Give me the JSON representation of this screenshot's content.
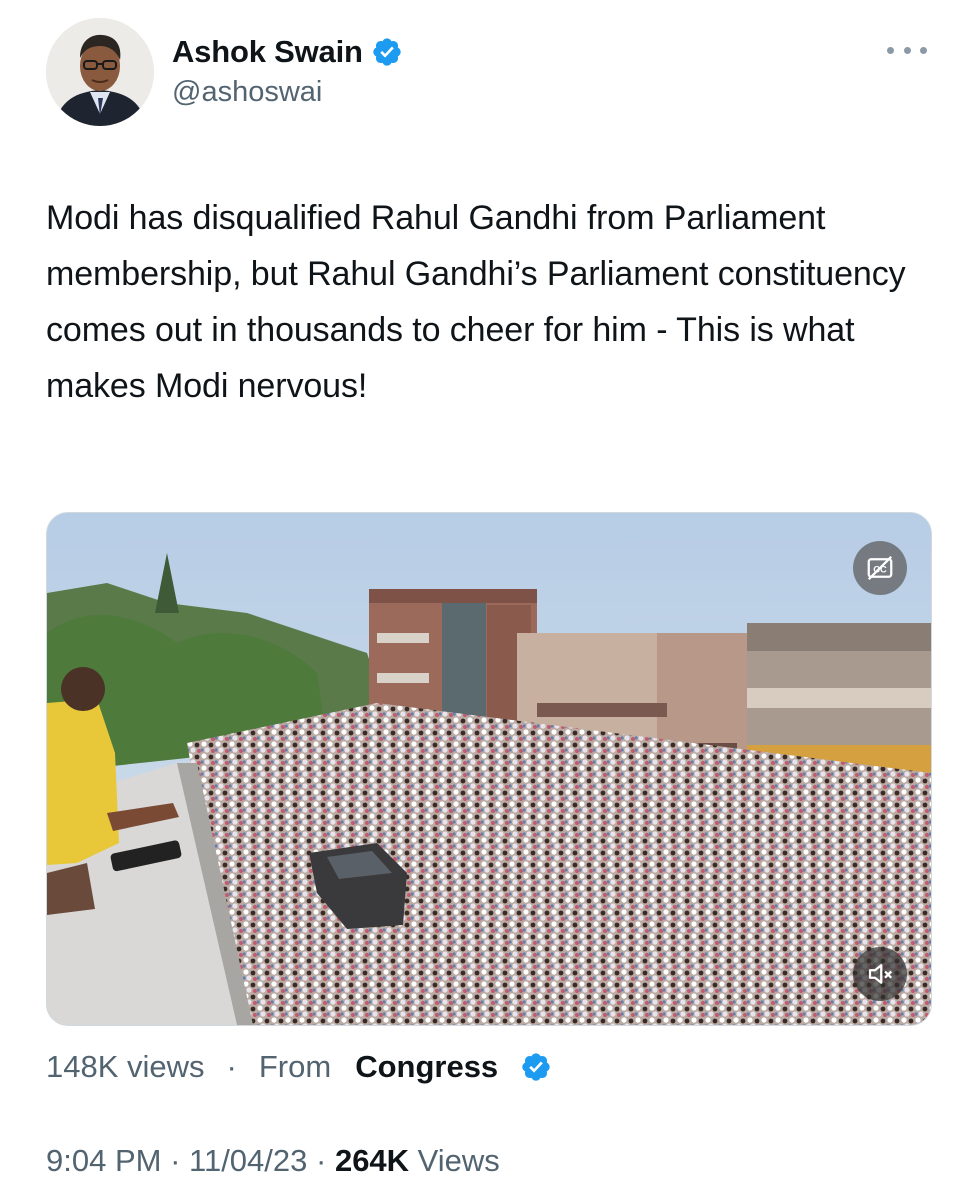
{
  "author": {
    "display_name": "Ashok Swain",
    "handle": "@ashoswai",
    "verified": true
  },
  "tweet": {
    "text": "Modi has disqualified Rahul Gandhi from Parliament membership, but Rahul Gandhi’s Parliament constituency comes out in thousands to cheer for him - This is what makes Modi nervous!"
  },
  "media": {
    "type": "video",
    "views": "148K views",
    "separator": "·",
    "from_label": "From",
    "source": "Congress",
    "source_verified": true,
    "icons": [
      "closed-captions-icon",
      "muted-speaker-icon"
    ]
  },
  "meta": {
    "time": "9:04 PM",
    "sep1": " · ",
    "date": "11/04/23",
    "sep2": " · ",
    "views_count": "264K",
    "views_label": " Views"
  },
  "colors": {
    "verified": "#1d9bf0",
    "secondary_text": "#536471",
    "primary_text": "#0f1419"
  }
}
